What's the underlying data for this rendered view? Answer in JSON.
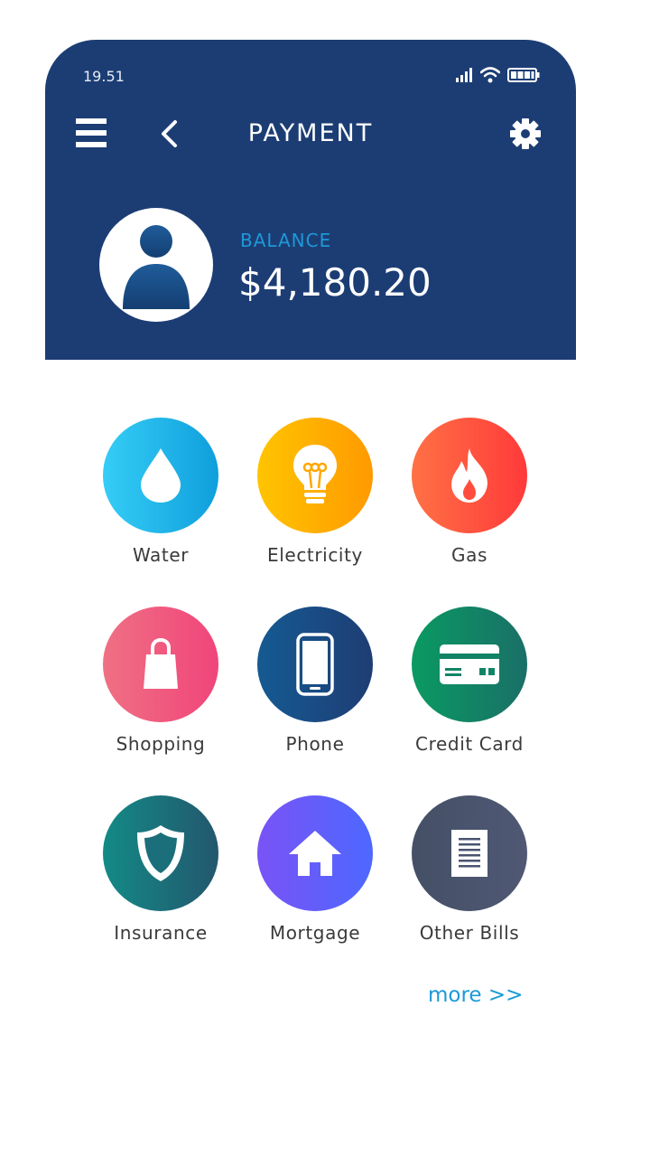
{
  "status": {
    "time": "19.51"
  },
  "header": {
    "title": "PAYMENT"
  },
  "balance": {
    "label": "BALANCE",
    "amount": "$4,180.20"
  },
  "categories": [
    {
      "label": "Water",
      "icon": "water-drop-icon",
      "colors": [
        "#35cdf6",
        "#0f9fdc"
      ]
    },
    {
      "label": "Electricity",
      "icon": "lightbulb-icon",
      "colors": [
        "#ffc400",
        "#ff9a00"
      ]
    },
    {
      "label": "Gas",
      "icon": "flame-icon",
      "colors": [
        "#ff7145",
        "#ff3a3a"
      ]
    },
    {
      "label": "Shopping",
      "icon": "shopping-bag-icon",
      "colors": [
        "#ef7084",
        "#f0457a"
      ]
    },
    {
      "label": "Phone",
      "icon": "smartphone-icon",
      "colors": [
        "#155a92",
        "#1e3d74"
      ]
    },
    {
      "label": "Credit Card",
      "icon": "credit-card-icon",
      "colors": [
        "#0a9a62",
        "#1a6f67"
      ]
    },
    {
      "label": "Insurance",
      "icon": "shield-icon",
      "colors": [
        "#138a86",
        "#23576e"
      ]
    },
    {
      "label": "Mortgage",
      "icon": "house-icon",
      "colors": [
        "#7a53f6",
        "#4d68ff"
      ]
    },
    {
      "label": "Other Bills",
      "icon": "document-icon",
      "colors": [
        "#445066",
        "#505874"
      ]
    }
  ],
  "more_link": "more >>",
  "colors": {
    "header_bg": "#1c3d74",
    "accent": "#1e98d6"
  }
}
